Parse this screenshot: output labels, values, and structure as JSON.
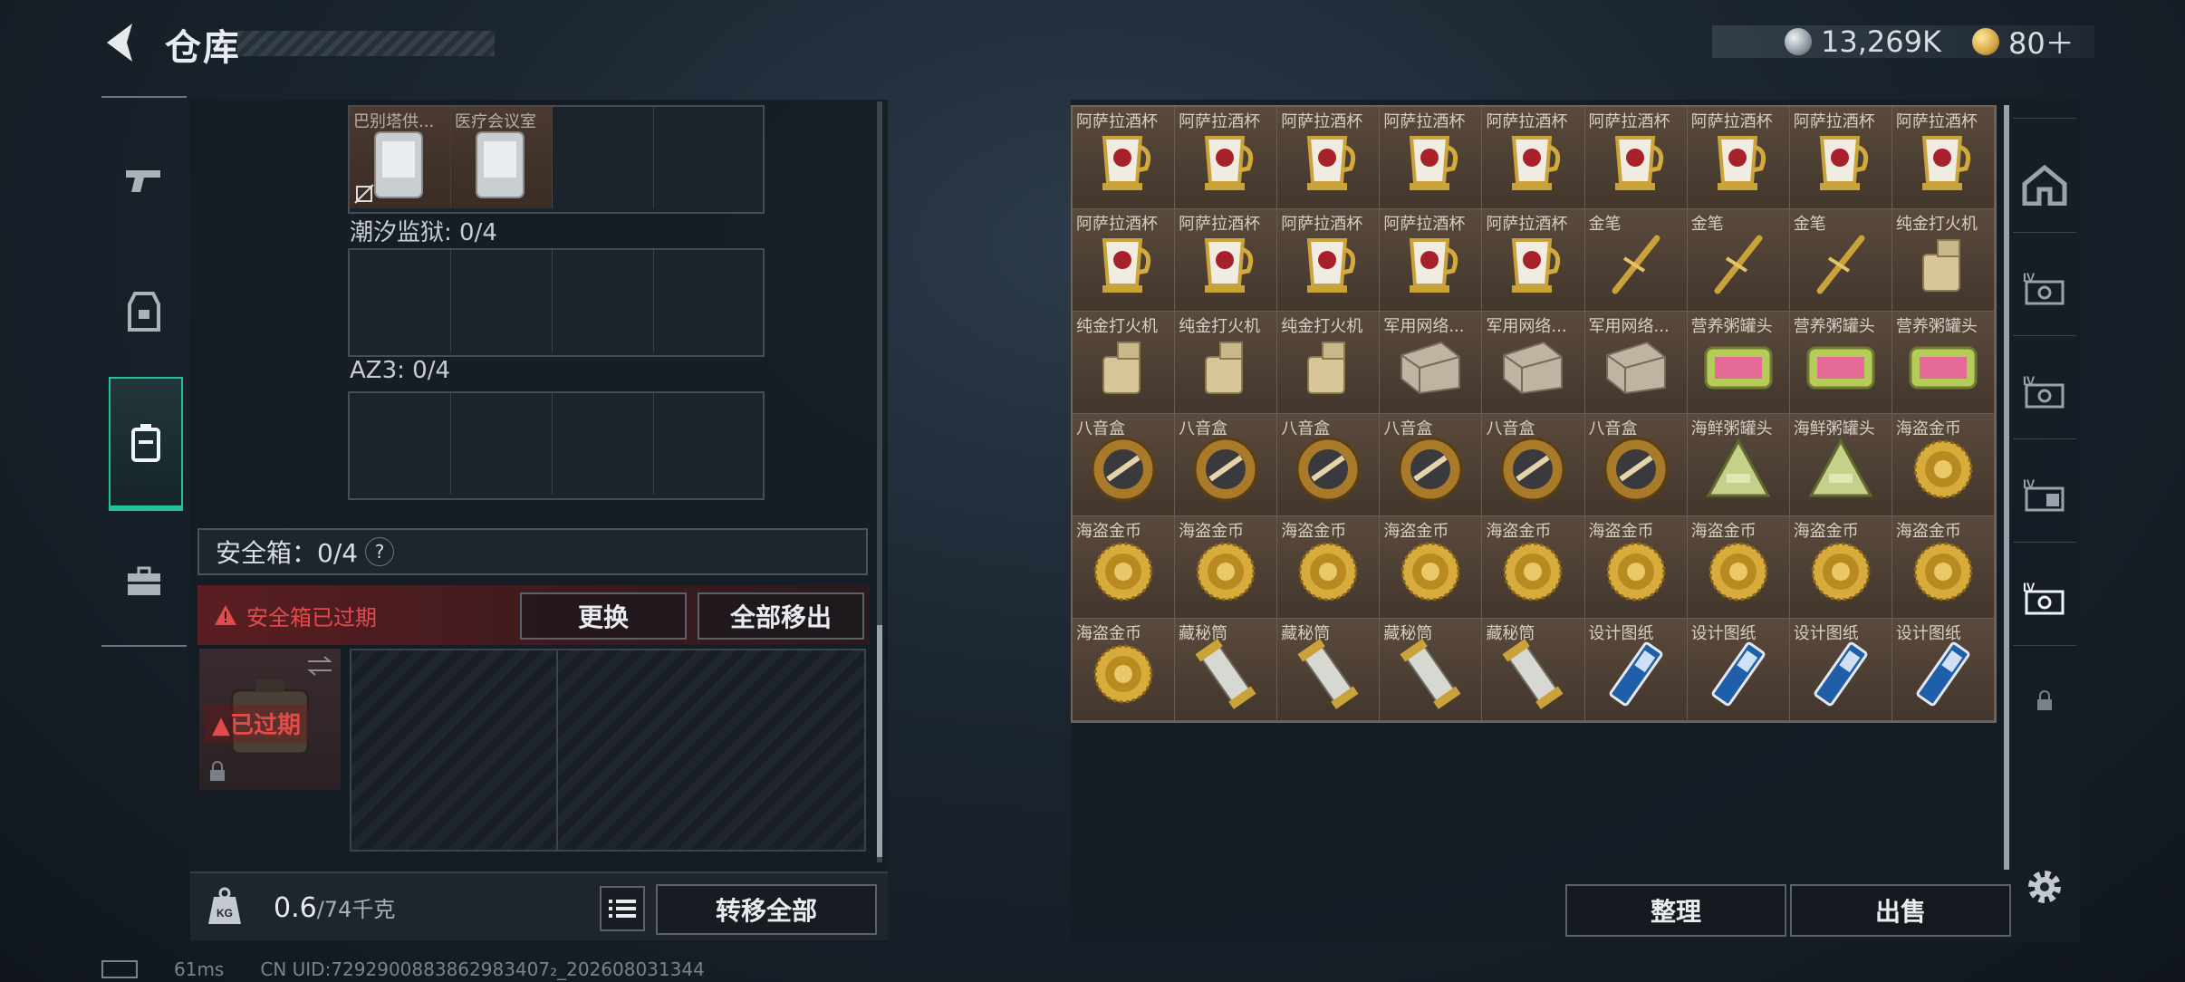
{
  "header": {
    "title": "仓库"
  },
  "currency": {
    "silver": "13,269K",
    "gold": "80＋"
  },
  "left": {
    "slots_top": [
      {
        "label": "巴别塔供..."
      },
      {
        "label": "医疗会议室"
      },
      {
        "label": ""
      },
      {
        "label": ""
      }
    ],
    "section1": "潮汐监狱: 0/4",
    "section2": "AZ3: 0/4",
    "safebox_label": "安全箱：0/4",
    "safebox_help": "?",
    "expired_notice": "安全箱已过期",
    "replace_button": "更换",
    "remove_all_button": "全部移出",
    "case_expired": "已过期",
    "weight_value": "0.6",
    "weight_capacity": "/74千克",
    "transfer_all_button": "转移全部"
  },
  "inventory": {
    "items": [
      {
        "name": "阿萨拉酒杯",
        "icon": "cup"
      },
      {
        "name": "阿萨拉酒杯",
        "icon": "cup"
      },
      {
        "name": "阿萨拉酒杯",
        "icon": "cup"
      },
      {
        "name": "阿萨拉酒杯",
        "icon": "cup"
      },
      {
        "name": "阿萨拉酒杯",
        "icon": "cup"
      },
      {
        "name": "阿萨拉酒杯",
        "icon": "cup"
      },
      {
        "name": "阿萨拉酒杯",
        "icon": "cup"
      },
      {
        "name": "阿萨拉酒杯",
        "icon": "cup"
      },
      {
        "name": "阿萨拉酒杯",
        "icon": "cup"
      },
      {
        "name": "阿萨拉酒杯",
        "icon": "cup"
      },
      {
        "name": "阿萨拉酒杯",
        "icon": "cup"
      },
      {
        "name": "阿萨拉酒杯",
        "icon": "cup"
      },
      {
        "name": "阿萨拉酒杯",
        "icon": "cup"
      },
      {
        "name": "阿萨拉酒杯",
        "icon": "cup"
      },
      {
        "name": "金笔",
        "icon": "pen"
      },
      {
        "name": "金笔",
        "icon": "pen"
      },
      {
        "name": "金笔",
        "icon": "pen"
      },
      {
        "name": "纯金打火机",
        "icon": "lighter"
      },
      {
        "name": "纯金打火机",
        "icon": "lighter"
      },
      {
        "name": "纯金打火机",
        "icon": "lighter"
      },
      {
        "name": "纯金打火机",
        "icon": "lighter"
      },
      {
        "name": "军用网络...",
        "icon": "net"
      },
      {
        "name": "军用网络...",
        "icon": "net"
      },
      {
        "name": "军用网络...",
        "icon": "net"
      },
      {
        "name": "营养粥罐头",
        "icon": "can"
      },
      {
        "name": "营养粥罐头",
        "icon": "can"
      },
      {
        "name": "营养粥罐头",
        "icon": "can"
      },
      {
        "name": "八音盒",
        "icon": "musicbox"
      },
      {
        "name": "八音盒",
        "icon": "musicbox"
      },
      {
        "name": "八音盒",
        "icon": "musicbox"
      },
      {
        "name": "八音盒",
        "icon": "musicbox"
      },
      {
        "name": "八音盒",
        "icon": "musicbox"
      },
      {
        "name": "八音盒",
        "icon": "musicbox"
      },
      {
        "name": "海鲜粥罐头",
        "icon": "tri"
      },
      {
        "name": "海鲜粥罐头",
        "icon": "tri"
      },
      {
        "name": "海盗金币",
        "icon": "coin"
      },
      {
        "name": "海盗金币",
        "icon": "coin"
      },
      {
        "name": "海盗金币",
        "icon": "coin"
      },
      {
        "name": "海盗金币",
        "icon": "coin"
      },
      {
        "name": "海盗金币",
        "icon": "coin"
      },
      {
        "name": "海盗金币",
        "icon": "coin"
      },
      {
        "name": "海盗金币",
        "icon": "coin"
      },
      {
        "name": "海盗金币",
        "icon": "coin"
      },
      {
        "name": "海盗金币",
        "icon": "coin"
      },
      {
        "name": "海盗金币",
        "icon": "coin"
      },
      {
        "name": "海盗金币",
        "icon": "coin"
      },
      {
        "name": "藏秘筒",
        "icon": "cryptex"
      },
      {
        "name": "藏秘筒",
        "icon": "cryptex"
      },
      {
        "name": "藏秘筒",
        "icon": "cryptex"
      },
      {
        "name": "藏秘筒",
        "icon": "cryptex"
      },
      {
        "name": "设计图纸",
        "icon": "blueprint"
      },
      {
        "name": "设计图纸",
        "icon": "blueprint"
      },
      {
        "name": "设计图纸",
        "icon": "blueprint"
      },
      {
        "name": "设计图纸",
        "icon": "blueprint"
      }
    ],
    "sort_button": "整理",
    "sell_button": "出售"
  },
  "status": {
    "ping": "61ms",
    "uid": "CN UID:7292900883862983407₂_202608031344"
  }
}
